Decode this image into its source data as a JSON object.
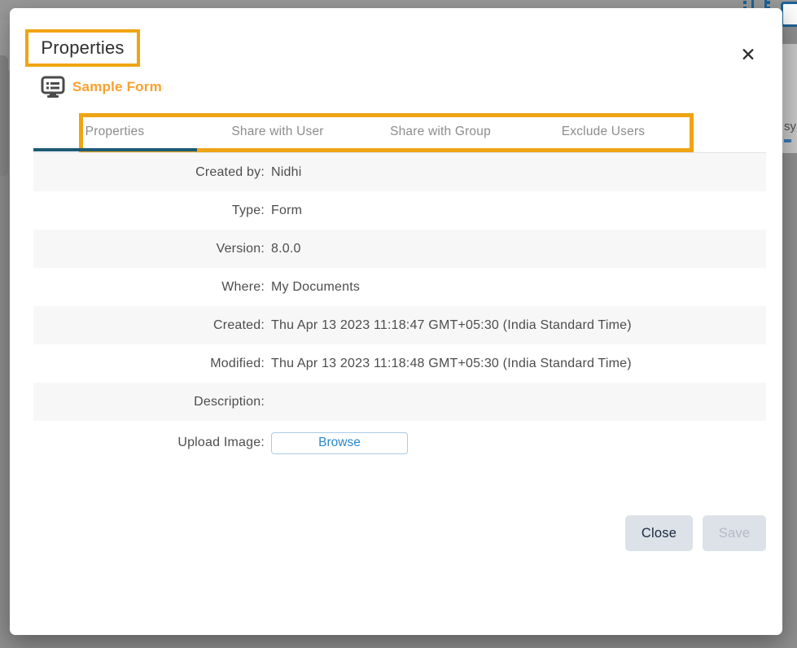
{
  "background": {
    "partial_text": "sy"
  },
  "icons": {
    "close": "✕"
  },
  "modal": {
    "title": "Properties",
    "form_name": "Sample Form",
    "tabs": [
      {
        "label": "Properties",
        "active": true
      },
      {
        "label": "Share with User",
        "active": false
      },
      {
        "label": "Share with Group",
        "active": false
      },
      {
        "label": "Exclude Users",
        "active": false
      }
    ],
    "properties": [
      {
        "label": "Created by:",
        "value": "Nidhi"
      },
      {
        "label": "Type:",
        "value": "Form"
      },
      {
        "label": "Version:",
        "value": "8.0.0"
      },
      {
        "label": "Where:",
        "value": "My Documents"
      },
      {
        "label": "Created:",
        "value": "Thu Apr 13 2023 11:18:47 GMT+05:30 (India Standard Time)"
      },
      {
        "label": "Modified:",
        "value": "Thu Apr 13 2023 11:18:48 GMT+05:30 (India Standard Time)"
      },
      {
        "label": "Description:",
        "value": ""
      },
      {
        "label": "Upload Image:",
        "value": "",
        "button_label": "Browse"
      }
    ],
    "footer": {
      "close_label": "Close",
      "save_label": "Save"
    }
  },
  "colors": {
    "annotation_orange": "#efa414",
    "form_name_orange": "#f7a12f",
    "tab_underline_teal": "#1e5b75",
    "browse_blue": "#2b87cb"
  }
}
